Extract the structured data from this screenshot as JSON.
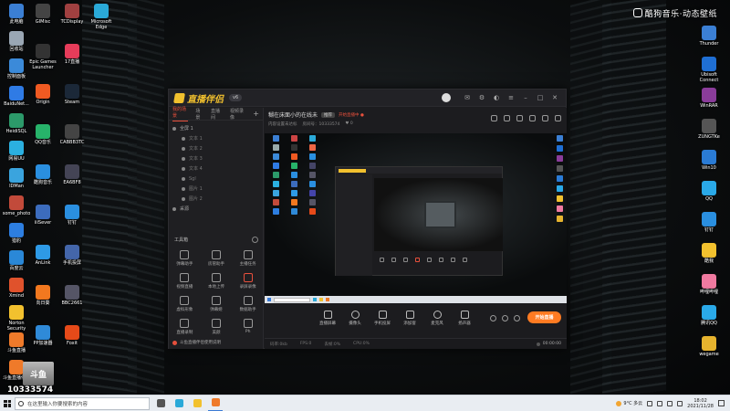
{
  "watermark": {
    "text": "酷狗音乐·动态壁纸"
  },
  "desktop_icons_left": [
    {
      "label": "此电脑",
      "color": "#3b7fd4"
    },
    {
      "label": "回收站",
      "color": "#9aa7b4"
    },
    {
      "label": "控制面板",
      "color": "#3b8ad9"
    },
    {
      "label": "BaiduNet...",
      "color": "#2f7be5"
    },
    {
      "label": "HeidiSQL",
      "color": "#2c9a6a"
    },
    {
      "label": "网易UU",
      "color": "#2bb0e0"
    },
    {
      "label": "IDMan",
      "color": "#3aa4de"
    },
    {
      "label": "some_photo",
      "color": "#c24a3a"
    },
    {
      "label": "猎豹",
      "color": "#2d7ee0"
    },
    {
      "label": "百度云",
      "color": "#2a88d8"
    },
    {
      "label": "Xmind",
      "color": "#e0522c"
    },
    {
      "label": "Norton Security",
      "color": "#f2c12e"
    },
    {
      "label": "斗鱼直播",
      "color": "#ef7a2a"
    },
    {
      "label": "斗鱼直播伴侣",
      "color": "#ef7a2a"
    }
  ],
  "desktop_icons_col2": [
    {
      "label": "GIMisc",
      "color": "#444"
    },
    {
      "label": "Epic Games Launcher",
      "color": "#333"
    },
    {
      "label": "Origin",
      "color": "#f05a22"
    },
    {
      "label": "QQ音乐",
      "color": "#27b36a"
    },
    {
      "label": "酷狗音乐",
      "color": "#2a8fe0"
    },
    {
      "label": "iiiSever",
      "color": "#3c6cbd"
    },
    {
      "label": "AnLink",
      "color": "#2e9ae6"
    },
    {
      "label": "向日葵",
      "color": "#f2781f"
    },
    {
      "label": "PP加速器",
      "color": "#2f8ad8"
    }
  ],
  "desktop_icons_col3": [
    {
      "label": "TCDisplay",
      "color": "#a04040"
    },
    {
      "label": "17直播",
      "color": "#e63c5a"
    },
    {
      "label": "Steam",
      "color": "#1b2838"
    },
    {
      "label": "CABBB3TC",
      "color": "#444"
    },
    {
      "label": "EA6BF8",
      "color": "#445"
    },
    {
      "label": "钉钉",
      "color": "#2a8fe0"
    },
    {
      "label": "手机投屏",
      "color": "#4466aa"
    },
    {
      "label": "BBC2661",
      "color": "#556"
    },
    {
      "label": "Foxit",
      "color": "#e64a19"
    }
  ],
  "desktop_icons_col4": [
    {
      "label": "Microsoft Edge",
      "color": "#2aa9d8"
    }
  ],
  "desktop_icons_right": [
    {
      "label": "Thunder",
      "color": "#3b7fd4"
    },
    {
      "label": "Ubisoft Connect",
      "color": "#1f6fd4"
    },
    {
      "label": "WinRAR",
      "color": "#8a3c9a"
    },
    {
      "label": "ZUNGTKe",
      "color": "#555"
    },
    {
      "label": "Win10",
      "color": "#2a7bd5"
    },
    {
      "label": "QQ",
      "color": "#2aa9e8"
    },
    {
      "label": "钉钉",
      "color": "#2a8fe0"
    },
    {
      "label": "酷我",
      "color": "#f2c12e"
    },
    {
      "label": "哔哩哔哩",
      "color": "#f07aa0"
    },
    {
      "label": "腾讯QQ",
      "color": "#2aa9e8"
    },
    {
      "label": "wegame",
      "color": "#e6b32e"
    }
  ],
  "app": {
    "brand": "直播伴侣",
    "version": "v6",
    "scene_tabs": [
      "我的场景",
      "场景",
      "直播间",
      "视频录像"
    ],
    "scene_tab_active": 0,
    "sources": [
      {
        "label": "全屏 1",
        "child": false
      },
      {
        "label": "文本 1",
        "child": true
      },
      {
        "label": "文本 2",
        "child": true
      },
      {
        "label": "文本 3",
        "child": true
      },
      {
        "label": "文本 4",
        "child": true
      },
      {
        "label": "Sgl",
        "child": true
      },
      {
        "label": "图片 1",
        "child": true
      },
      {
        "label": "图片 2",
        "child": true
      },
      {
        "label": "采源",
        "child": false
      }
    ],
    "tools_title": "工具箱",
    "tools": [
      {
        "label": "弹幕助手",
        "hot": false
      },
      {
        "label": "房管助手",
        "hot": false
      },
      {
        "label": "主播任务",
        "hot": false
      },
      {
        "label": "视频直播",
        "hot": false
      },
      {
        "label": "本地上传",
        "hot": false
      },
      {
        "label": "录屏录像",
        "hot": true
      },
      {
        "label": "虚拟形象",
        "hot": false
      },
      {
        "label": "弹幕姬",
        "hot": false
      },
      {
        "label": "数据助手",
        "hot": false
      },
      {
        "label": "直播录制",
        "hot": false
      },
      {
        "label": "美颜",
        "hot": false
      },
      {
        "label": "Ph",
        "hot": false
      }
    ],
    "notice": "斗鱼直播伴侣使用说明",
    "room": {
      "title": "糊在床面小的在线未",
      "tag": "推荐",
      "live_label": "开始直播中 ●",
      "sub_left": "内容设置未达标",
      "sub_room": "房间号：10333574",
      "sub_fans": "0"
    },
    "controls": [
      {
        "label": "直播屏幕",
        "round": false
      },
      {
        "label": "摄像头",
        "round": true
      },
      {
        "label": "手机投屏",
        "round": false
      },
      {
        "label": "添加窗",
        "round": false
      },
      {
        "label": "麦克风",
        "round": true
      },
      {
        "label": "扬声器",
        "round": false
      }
    ],
    "go_live": "开始直播",
    "status": {
      "bitrate": "码率:0kb",
      "fps": "FPS:0",
      "drop": "丢帧:0%",
      "cpu": "CPU:0%",
      "timer": "00:00:00"
    }
  },
  "badge": {
    "text": "斗鱼",
    "counter": "10333574"
  },
  "taskbar": {
    "search_placeholder": "在这里输入你要搜索的内容",
    "apps": [
      {
        "name": "task-view",
        "color": "#555"
      },
      {
        "name": "edge",
        "color": "#2aa9d8"
      },
      {
        "name": "explorer",
        "color": "#f2c12e"
      },
      {
        "name": "douyu",
        "color": "#ef7a2a"
      }
    ],
    "weather": "9°C 多云",
    "time": "18:02",
    "date": "2021/11/28"
  }
}
